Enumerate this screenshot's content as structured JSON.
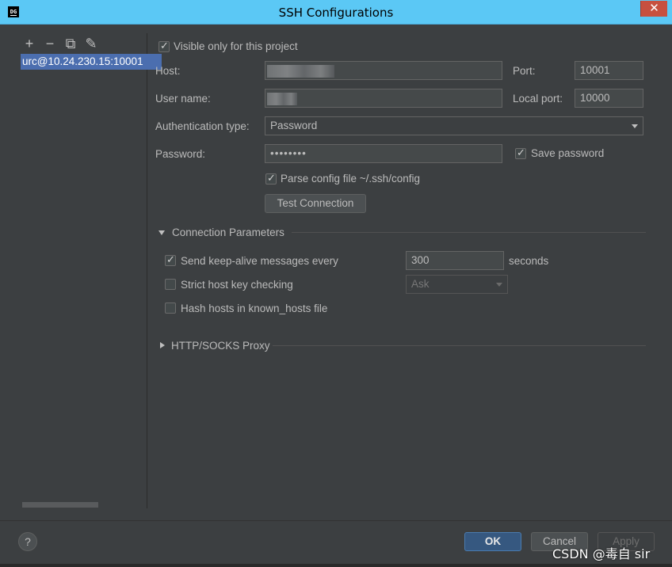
{
  "window": {
    "title": "SSH Configurations",
    "app_icon_text": "DG",
    "close_glyph": "✕"
  },
  "sidebar": {
    "tools": [
      {
        "name": "add-icon",
        "glyph": "+"
      },
      {
        "name": "remove-icon",
        "glyph": "−"
      },
      {
        "name": "copy-icon",
        "glyph": "⧉"
      },
      {
        "name": "edit-icon",
        "glyph": "✎"
      }
    ],
    "selected_item": "urc@10.24.230.15:10001"
  },
  "form": {
    "visible_only_label": "Visible only for this project",
    "visible_only_checked": true,
    "host_label": "Host:",
    "host_value": "",
    "port_label": "Port:",
    "port_value": "10001",
    "user_label": "User name:",
    "user_value": "",
    "local_port_label": "Local port:",
    "local_port_value": "10000",
    "auth_label": "Authentication type:",
    "auth_value": "Password",
    "password_label": "Password:",
    "password_value": "••••••••",
    "save_password_label": "Save password",
    "save_password_checked": true,
    "parse_config_label": "Parse config file ~/.ssh/config",
    "parse_config_checked": true,
    "test_connection_label": "Test Connection"
  },
  "connection_params": {
    "header": "Connection Parameters",
    "keepalive_label": "Send keep-alive messages every",
    "keepalive_checked": true,
    "keepalive_value": "300",
    "keepalive_unit": "seconds",
    "strict_host_label": "Strict host key checking",
    "strict_host_checked": false,
    "strict_host_value": "Ask",
    "hash_hosts_label": "Hash hosts in known_hosts file",
    "hash_hosts_checked": false
  },
  "proxy": {
    "header": "HTTP/SOCKS Proxy"
  },
  "footer": {
    "help_label": "?",
    "ok_label": "OK",
    "cancel_label": "Cancel",
    "apply_label": "Apply",
    "watermark": "CSDN @毒自 sir"
  }
}
